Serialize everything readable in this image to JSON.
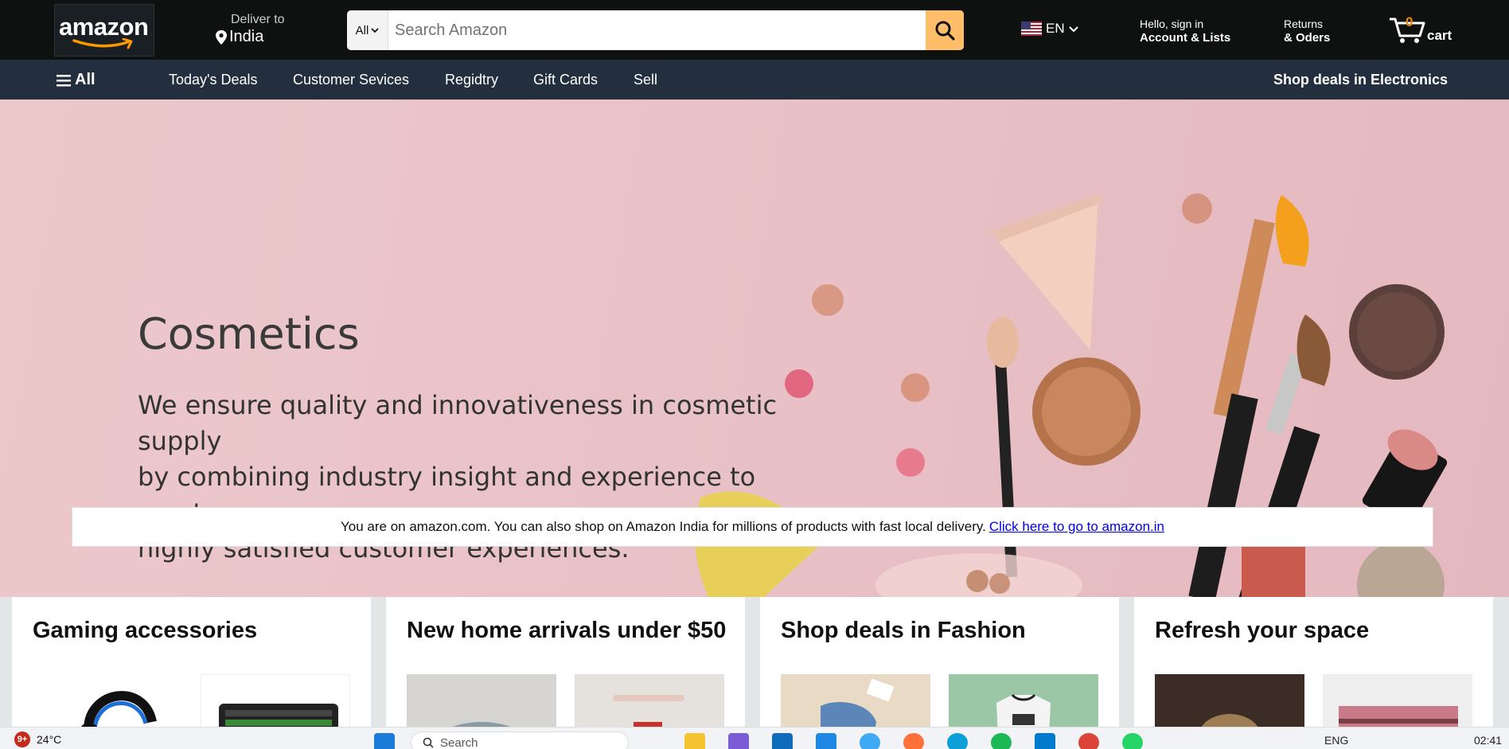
{
  "header": {
    "logo_text": "amazon",
    "deliver_label": "Deliver to",
    "deliver_location": "India",
    "search_category": "All",
    "search_placeholder": "Search Amazon",
    "language": "EN",
    "account_greeting": "Hello, sign in",
    "account_label": "Account & Lists",
    "returns_line1": "Returns",
    "returns_line2": "& Oders",
    "cart_count": "0",
    "cart_label": "cart"
  },
  "subnav": {
    "all_label": "All",
    "items": [
      "Today's Deals",
      "Customer Sevices",
      "Regidtry",
      "Gift Cards",
      "Sell"
    ],
    "deals_link": "Shop deals in Electronics"
  },
  "hero": {
    "title": "Cosmetics",
    "line1": "We ensure quality and innovativeness in cosmetic supply",
    "line2": "by combining industry insight and experience to create",
    "line3": "highly satisfied customer experiences."
  },
  "notice": {
    "text": "You are on amazon.com. You can also shop on Amazon India for millions of products with fast local delivery.",
    "link": "Click here to go to amazon.in"
  },
  "cards": [
    {
      "title": "Gaming accessories"
    },
    {
      "title": "New home arrivals under $50"
    },
    {
      "title": "Shop deals in Fashion"
    },
    {
      "title": "Refresh your space"
    }
  ],
  "taskbar": {
    "badge": "9+",
    "temperature": "24°C",
    "search_placeholder": "Search",
    "language": "ENG",
    "time": "02:41"
  },
  "colors": {
    "nav_bg": "#0f1111",
    "subnav_bg": "#232f3e",
    "search_button": "#febd69",
    "cart_count": "#f08804",
    "hero_bg": "#ecc8cb"
  }
}
